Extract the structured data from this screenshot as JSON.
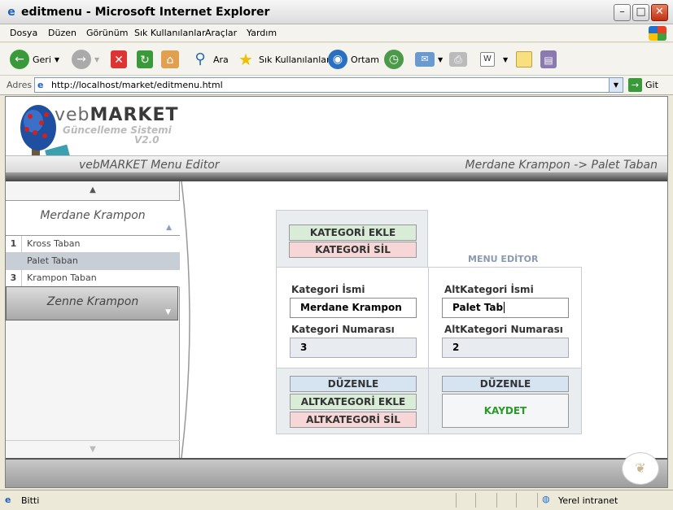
{
  "window": {
    "title": "editmenu - Microsoft Internet Explorer"
  },
  "menu": [
    "Dosya",
    "Düzen",
    "Görünüm",
    "Sık Kullanılanlar",
    "Araçlar",
    "Yardım"
  ],
  "toolbar": {
    "back": "Geri",
    "search": "Ara",
    "favorites": "Sık Kullanılanlar",
    "media": "Ortam"
  },
  "address": {
    "label": "Adres",
    "url": "http://localhost/market/editmenu.html",
    "go": "Git"
  },
  "logo": {
    "brand_light": "veb",
    "brand_bold": "MARKET",
    "subtitle": "Güncelleme Sistemi",
    "version": "V2.0"
  },
  "header": {
    "title": "vebMARKET Menu Editor",
    "breadcrumb": "Merdane Krampon -> Palet Taban"
  },
  "sidebar": {
    "open_category": "Merdane Krampon",
    "subitems": [
      {
        "num": "1",
        "label": "Kross Taban"
      },
      {
        "num": "",
        "label": "Palet Taban"
      },
      {
        "num": "3",
        "label": "Krampon Taban"
      }
    ],
    "closed_category": "Zenne Krampon"
  },
  "editor": {
    "title": "MENU EDİTOR",
    "add_category": "KATEGORİ EKLE",
    "delete_category": "KATEGORİ SİL",
    "category_name_label": "Kategori İsmi",
    "category_name_value": "Merdane Krampon",
    "category_number_label": "Kategori Numarası",
    "category_number_value": "3",
    "subcategory_name_label": "AltKategori İsmi",
    "subcategory_name_value": "Palet Tab",
    "subcategory_number_label": "AltKategori Numarası",
    "subcategory_number_value": "2",
    "edit_left": "DÜZENLE",
    "add_subcategory": "ALTKATEGORİ EKLE",
    "delete_subcategory": "ALTKATEGORİ SİL",
    "edit_right": "DÜZENLE",
    "save": "KAYDET"
  },
  "status": {
    "left": "Bitti",
    "zone": "Yerel intranet"
  },
  "colors": {
    "save_text": "#2a9a2a",
    "editor_title": "#8a9ab0"
  }
}
